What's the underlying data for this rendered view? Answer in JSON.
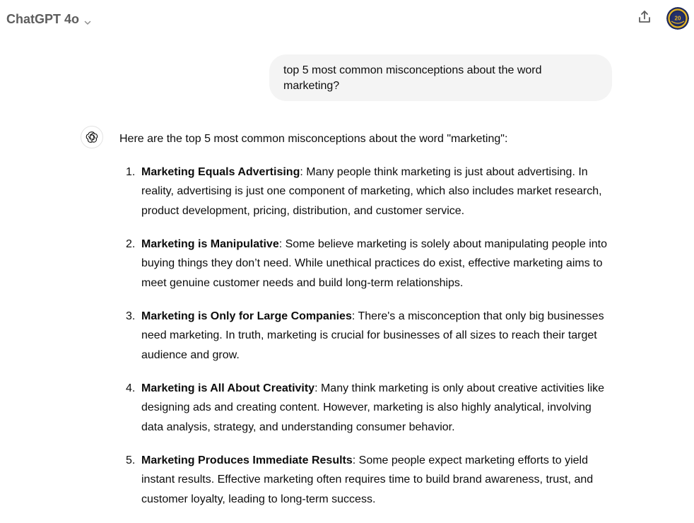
{
  "header": {
    "model_name": "ChatGPT 4o",
    "model_dropdown_icon": "chevron-down-icon",
    "share_icon": "share-upload-icon",
    "avatar_icon": "user-avatar",
    "avatar_text": "20"
  },
  "conversation": {
    "user_message": "top 5 most common misconceptions about the word marketing?",
    "assistant_icon": "openai-logo-icon",
    "assistant_intro": "Here are the top 5 most common misconceptions about the word \"marketing\":",
    "items": [
      {
        "number": "1.",
        "title": "Marketing Equals Advertising",
        "body": ": Many people think marketing is just about advertising. In reality, advertising is just one component of marketing, which also includes market research, product development, pricing, distribution, and customer service."
      },
      {
        "number": "2.",
        "title": "Marketing is Manipulative",
        "body": ": Some believe marketing is solely about manipulating people into buying things they don’t need. While unethical practices do exist, effective marketing aims to meet genuine customer needs and build long-term relationships."
      },
      {
        "number": "3.",
        "title": "Marketing is Only for Large Companies",
        "body": ": There's a misconception that only big businesses need marketing. In truth, marketing is crucial for businesses of all sizes to reach their target audience and grow."
      },
      {
        "number": "4.",
        "title": "Marketing is All About Creativity",
        "body": ": Many think marketing is only about creative activities like designing ads and creating content. However, marketing is also highly analytical, involving data analysis, strategy, and understanding consumer behavior."
      },
      {
        "number": "5.",
        "title": "Marketing Produces Immediate Results",
        "body": ": Some people expect marketing efforts to yield instant results. Effective marketing often requires time to build brand awareness, trust, and customer loyalty, leading to long-term success."
      }
    ]
  },
  "colors": {
    "user_bubble_bg": "#f4f4f4",
    "header_text": "#5d5d5d",
    "body_text": "#0d0d0d",
    "avatar_navy": "#1f2a5c",
    "avatar_gold": "#e9b824"
  }
}
